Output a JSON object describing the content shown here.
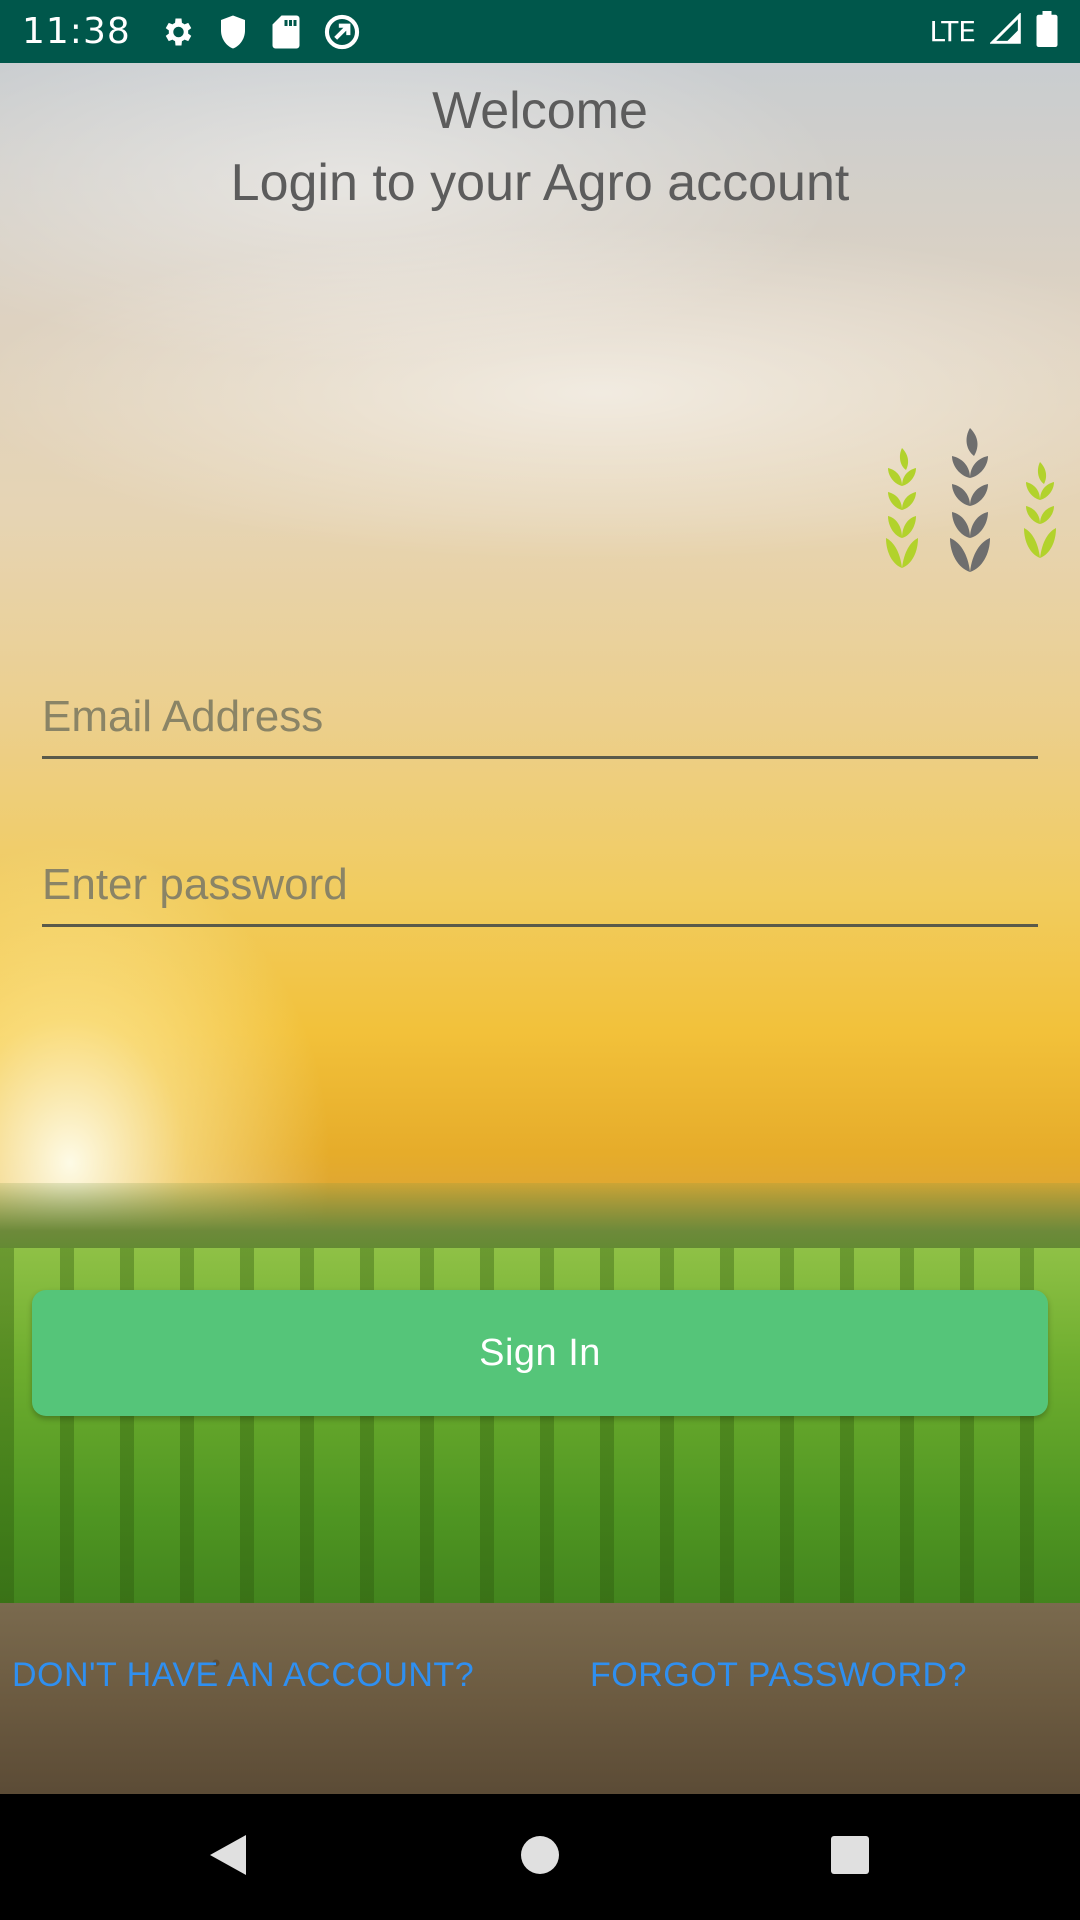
{
  "status_bar": {
    "time": "11:38",
    "network": "LTE",
    "icons": [
      "settings-icon",
      "shield-icon",
      "sd-card-icon",
      "sync-icon",
      "signal-icon",
      "battery-icon"
    ]
  },
  "header": {
    "welcome": "Welcome",
    "subtitle": "Login to your Agro account"
  },
  "logo": {
    "icon": "wheat-logo-icon",
    "colors": {
      "side": "#b2d22c",
      "center": "#6e6e6e"
    }
  },
  "form": {
    "email_placeholder": "Email Address",
    "email_value": "",
    "password_placeholder": "Enter password",
    "password_value": "",
    "sign_in_label": "Sign In"
  },
  "links": {
    "signup": "Don't have an account?",
    "forgot": "Forgot password?"
  },
  "colors": {
    "status_bar": "#00574b",
    "button": "#55c579",
    "link": "#2f8ff0"
  },
  "nav_bar": {
    "icons": [
      "back-icon",
      "home-icon",
      "recents-icon"
    ]
  }
}
